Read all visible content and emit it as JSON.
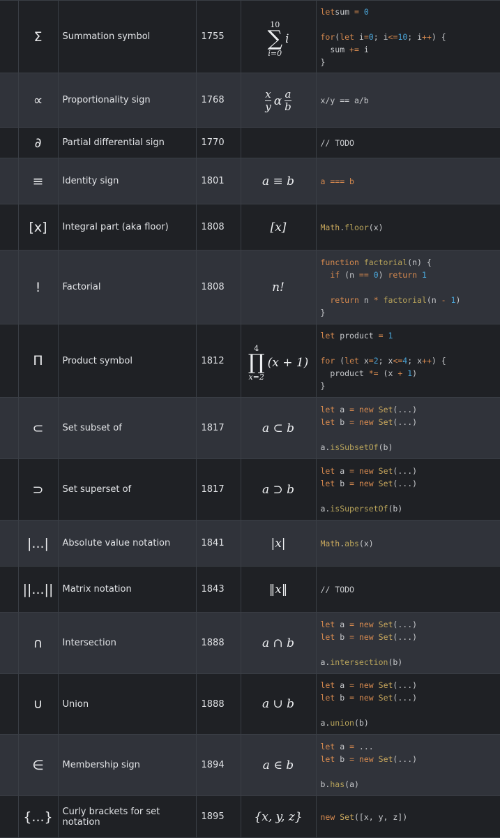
{
  "rows": [
    {
      "symbol": "Σ",
      "name": "Summation symbol",
      "year": "1755",
      "math": {
        "kind": "sum",
        "upper": "10",
        "lower": "i=0",
        "body": "i"
      },
      "code": [
        [
          [
            "kw",
            "let"
          ],
          [
            "",
            "sum "
          ],
          [
            "op",
            "="
          ],
          [
            "num",
            " 0"
          ]
        ],
        [],
        [
          [
            "kw",
            "for"
          ],
          [
            "",
            "("
          ],
          [
            "kw",
            "let"
          ],
          [
            "",
            " i"
          ],
          [
            "op",
            "="
          ],
          [
            "num",
            "0"
          ],
          [
            "",
            ";"
          ],
          [
            "",
            " i"
          ],
          [
            "op",
            "<="
          ],
          [
            "num",
            "10"
          ],
          [
            "",
            ";"
          ],
          [
            "",
            " i"
          ],
          [
            "op",
            "++"
          ],
          [
            "",
            ") {"
          ]
        ],
        [
          [
            "",
            "  sum "
          ],
          [
            "op",
            "+="
          ],
          [
            "",
            " i"
          ]
        ],
        [
          [
            "",
            "}"
          ]
        ]
      ]
    },
    {
      "symbol": "∝",
      "name": "Proportionality sign",
      "year": "1768",
      "math": {
        "kind": "prop"
      },
      "code": [
        [
          [
            "",
            "x/y == a/b"
          ]
        ]
      ]
    },
    {
      "symbol": "∂",
      "name": "Partial differential sign",
      "year": "1770",
      "math": {
        "kind": "text",
        "text": ""
      },
      "code": [
        [
          [
            "",
            "// TODO"
          ]
        ]
      ]
    },
    {
      "symbol": "≡",
      "name": "Identity sign",
      "year": "1801",
      "math": {
        "kind": "text",
        "text": "a ≡ b"
      },
      "code": [
        [
          [
            "kw",
            "a === b"
          ]
        ]
      ]
    },
    {
      "symbol": "[x]",
      "name": "Integral part (aka floor)",
      "year": "1808",
      "math": {
        "kind": "text",
        "text": "[x]"
      },
      "code": [
        [
          [
            "cls",
            "Math"
          ],
          [
            "",
            "."
          ],
          [
            "fn",
            "floor"
          ],
          [
            "",
            "(x)"
          ]
        ]
      ]
    },
    {
      "symbol": "!",
      "name": "Factorial",
      "year": "1808",
      "math": {
        "kind": "text",
        "text": "n!"
      },
      "code": [
        [
          [
            "kw",
            "function"
          ],
          [
            "",
            " "
          ],
          [
            "fn",
            "factorial"
          ],
          [
            "",
            "(n) {"
          ]
        ],
        [
          [
            "",
            "  "
          ],
          [
            "kw",
            "if"
          ],
          [
            "",
            " (n "
          ],
          [
            "op",
            "=="
          ],
          [
            "num",
            " 0"
          ],
          [
            "",
            ") "
          ],
          [
            "kw",
            "return"
          ],
          [
            "num",
            " 1"
          ]
        ],
        [],
        [
          [
            "",
            "  "
          ],
          [
            "kw",
            "return"
          ],
          [
            "",
            " n "
          ],
          [
            "op",
            "*"
          ],
          [
            "",
            " "
          ],
          [
            "fn",
            "factorial"
          ],
          [
            "",
            "(n "
          ],
          [
            "op",
            "-"
          ],
          [
            "num",
            " 1"
          ],
          [
            "",
            ")"
          ]
        ],
        [
          [
            "",
            "}"
          ]
        ]
      ]
    },
    {
      "symbol": "Π",
      "name": "Product symbol",
      "year": "1812",
      "math": {
        "kind": "prod",
        "upper": "4",
        "lower": "x=2",
        "body": "(x + 1)"
      },
      "code": [
        [
          [
            "kw",
            "let"
          ],
          [
            "",
            " product "
          ],
          [
            "op",
            "="
          ],
          [
            "num",
            " 1"
          ]
        ],
        [],
        [
          [
            "kw",
            "for"
          ],
          [
            "",
            " ("
          ],
          [
            "kw",
            "let"
          ],
          [
            "",
            " x"
          ],
          [
            "op",
            "="
          ],
          [
            "num",
            "2"
          ],
          [
            "",
            "; x"
          ],
          [
            "op",
            "<="
          ],
          [
            "num",
            "4"
          ],
          [
            "",
            "; x"
          ],
          [
            "op",
            "++"
          ],
          [
            "",
            ") {"
          ]
        ],
        [
          [
            "",
            "  product "
          ],
          [
            "op",
            "*="
          ],
          [
            "",
            " (x "
          ],
          [
            "op",
            "+"
          ],
          [
            "num",
            " 1"
          ],
          [
            "",
            ")"
          ]
        ],
        [
          [
            "",
            "}"
          ]
        ]
      ]
    },
    {
      "symbol": "⊂",
      "name": "Set subset of",
      "year": "1817",
      "math": {
        "kind": "text",
        "text": "a ⊂ b"
      },
      "code": [
        [
          [
            "kw",
            "let"
          ],
          [
            "",
            " a "
          ],
          [
            "op",
            "="
          ],
          [
            "kw",
            " new"
          ],
          [
            "",
            " "
          ],
          [
            "cls",
            "Set"
          ],
          [
            "",
            "(...)"
          ]
        ],
        [
          [
            "kw",
            "let"
          ],
          [
            "",
            " b "
          ],
          [
            "op",
            "="
          ],
          [
            "kw",
            " new"
          ],
          [
            "",
            " "
          ],
          [
            "cls",
            "Set"
          ],
          [
            "",
            "(...)"
          ]
        ],
        [],
        [
          [
            "",
            "a."
          ],
          [
            "fn",
            "isSubsetOf"
          ],
          [
            "",
            "(b)"
          ]
        ]
      ]
    },
    {
      "symbol": "⊃",
      "name": "Set superset of",
      "year": "1817",
      "math": {
        "kind": "text",
        "text": "a ⊃ b"
      },
      "code": [
        [
          [
            "kw",
            "let"
          ],
          [
            "",
            " a "
          ],
          [
            "op",
            "="
          ],
          [
            "kw",
            " new"
          ],
          [
            "",
            " "
          ],
          [
            "cls",
            "Set"
          ],
          [
            "",
            "(...)"
          ]
        ],
        [
          [
            "kw",
            "let"
          ],
          [
            "",
            " b "
          ],
          [
            "op",
            "="
          ],
          [
            "kw",
            " new"
          ],
          [
            "",
            " "
          ],
          [
            "cls",
            "Set"
          ],
          [
            "",
            "(...)"
          ]
        ],
        [],
        [
          [
            "",
            "a."
          ],
          [
            "fn",
            "isSupersetOf"
          ],
          [
            "",
            "(b)"
          ]
        ]
      ]
    },
    {
      "symbol": "|...|",
      "name": "Absolute value notation",
      "year": "1841",
      "math": {
        "kind": "text",
        "text": "|x|"
      },
      "code": [
        [
          [
            "cls",
            "Math"
          ],
          [
            "",
            "."
          ],
          [
            "fn",
            "abs"
          ],
          [
            "",
            "(x)"
          ]
        ]
      ]
    },
    {
      "symbol": "||...||",
      "name": "Matrix notation",
      "year": "1843",
      "math": {
        "kind": "text",
        "text": "‖x‖"
      },
      "code": [
        [
          [
            "",
            "// TODO"
          ]
        ]
      ]
    },
    {
      "symbol": "∩",
      "name": "Intersection",
      "year": "1888",
      "math": {
        "kind": "text",
        "text": "a ∩ b"
      },
      "code": [
        [
          [
            "kw",
            "let"
          ],
          [
            "",
            " a "
          ],
          [
            "op",
            "="
          ],
          [
            "kw",
            " new"
          ],
          [
            "",
            " "
          ],
          [
            "cls",
            "Set"
          ],
          [
            "",
            "(...)"
          ]
        ],
        [
          [
            "kw",
            "let"
          ],
          [
            "",
            " b "
          ],
          [
            "op",
            "="
          ],
          [
            "kw",
            " new"
          ],
          [
            "",
            " "
          ],
          [
            "cls",
            "Set"
          ],
          [
            "",
            "(...)"
          ]
        ],
        [],
        [
          [
            "",
            "a."
          ],
          [
            "fn",
            "intersection"
          ],
          [
            "",
            "(b)"
          ]
        ]
      ]
    },
    {
      "symbol": "∪",
      "name": "Union",
      "year": "1888",
      "math": {
        "kind": "text",
        "text": "a ∪ b"
      },
      "code": [
        [
          [
            "kw",
            "let"
          ],
          [
            "",
            " a "
          ],
          [
            "op",
            "="
          ],
          [
            "kw",
            " new"
          ],
          [
            "",
            " "
          ],
          [
            "cls",
            "Set"
          ],
          [
            "",
            "(...)"
          ]
        ],
        [
          [
            "kw",
            "let"
          ],
          [
            "",
            " b "
          ],
          [
            "op",
            "="
          ],
          [
            "kw",
            " new"
          ],
          [
            "",
            " "
          ],
          [
            "cls",
            "Set"
          ],
          [
            "",
            "(...)"
          ]
        ],
        [],
        [
          [
            "",
            "a."
          ],
          [
            "fn",
            "union"
          ],
          [
            "",
            "(b)"
          ]
        ]
      ]
    },
    {
      "symbol": "∈",
      "name": "Membership sign",
      "year": "1894",
      "math": {
        "kind": "text",
        "text": "a ∈ b"
      },
      "code": [
        [
          [
            "kw",
            "let"
          ],
          [
            "",
            " a "
          ],
          [
            "op",
            "="
          ],
          [
            "",
            " ..."
          ]
        ],
        [
          [
            "kw",
            "let"
          ],
          [
            "",
            " b "
          ],
          [
            "op",
            "="
          ],
          [
            "kw",
            " new"
          ],
          [
            "",
            " "
          ],
          [
            "cls",
            "Set"
          ],
          [
            "",
            "(...)"
          ]
        ],
        [],
        [
          [
            "",
            "b."
          ],
          [
            "fn",
            "has"
          ],
          [
            "",
            "(a)"
          ]
        ]
      ]
    },
    {
      "symbol": "{...}",
      "name": "Curly brackets for set notation",
      "year": "1895",
      "math": {
        "kind": "text",
        "text": "{x, y, z}"
      },
      "code": [
        [
          [
            "kw",
            "new"
          ],
          [
            "",
            " "
          ],
          [
            "cls",
            "Set"
          ],
          [
            "",
            "([x, y, z])"
          ]
        ]
      ]
    }
  ],
  "colors": {
    "keyword": "#d78a4f",
    "function": "#b7a35a",
    "number": "#4aa5d8",
    "class": "#c9a85d",
    "row_dark": "#1f2125",
    "row_light": "#30333a",
    "border": "#3a3e45"
  }
}
